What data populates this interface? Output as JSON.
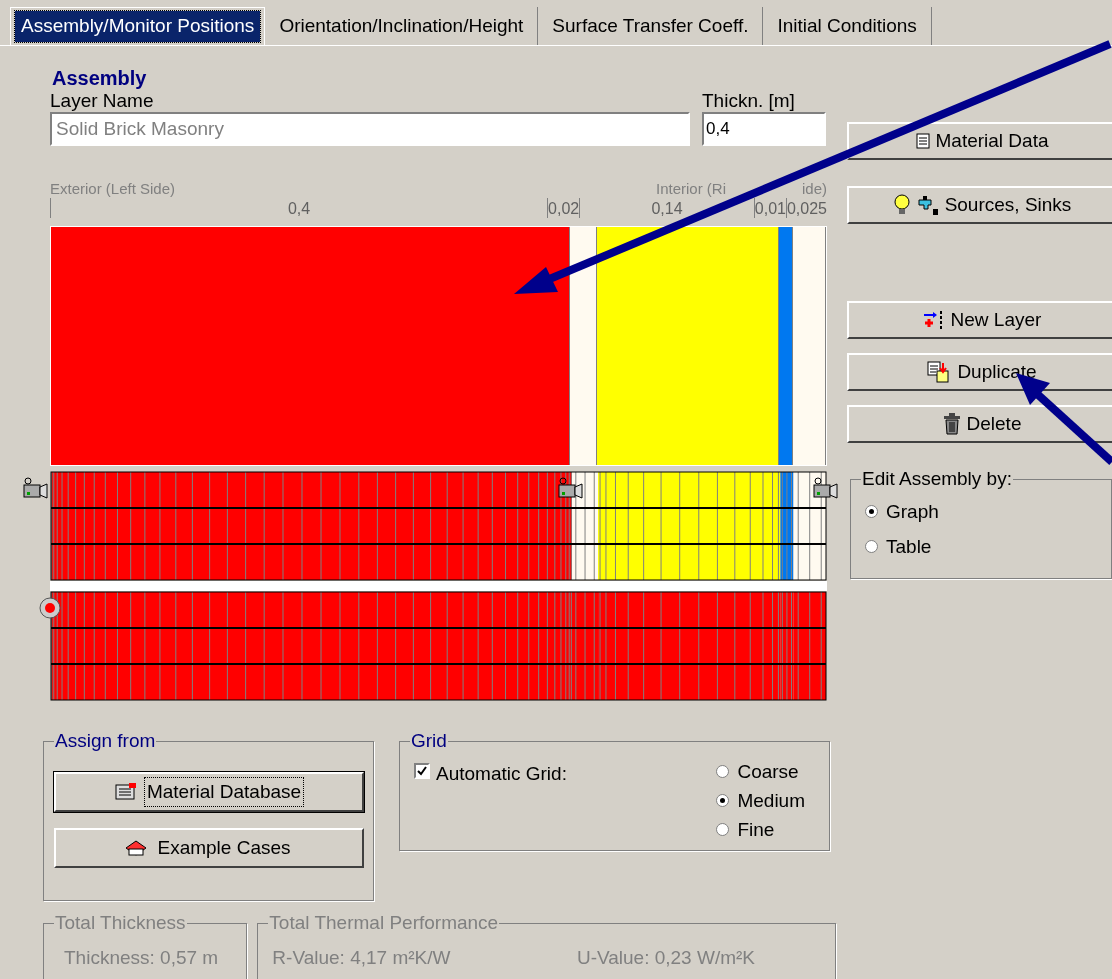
{
  "tabs": [
    {
      "label": "Assembly/Monitor Positions",
      "selected": true
    },
    {
      "label": "Orientation/Inclination/Height",
      "selected": false
    },
    {
      "label": "Surface Transfer Coeff.",
      "selected": false
    },
    {
      "label": "Initial Conditions",
      "selected": false
    }
  ],
  "assembly": {
    "title": "Assembly",
    "layer_name_label": "Layer Name",
    "layer_name_value": "Solid Brick Masonry",
    "layer_name_disabled": true,
    "thickness_label": "Thickn. [m]",
    "thickness_value": "0,4",
    "exterior_label": "Exterior (Left Side)",
    "interior_label": "Interior (Ri",
    "interior_label_tail": "ide)",
    "layers": [
      {
        "thickness": "0,4",
        "color": "#ff0000"
      },
      {
        "thickness": "0,02",
        "color": "#fffaf0"
      },
      {
        "thickness": "0,14",
        "color": "#ffff00"
      },
      {
        "thickness": "0,01",
        "color": "#0078f0"
      },
      {
        "thickness": "0,025",
        "color": "#fffaf0"
      }
    ]
  },
  "side_buttons": [
    {
      "label": "Material Data",
      "kind": "document"
    },
    {
      "label": "Sources, Sinks",
      "kind": "bulb-tap"
    },
    {
      "label": "New Layer",
      "kind": "new-layer"
    },
    {
      "label": "Duplicate",
      "kind": "duplicate"
    },
    {
      "label": "Delete",
      "kind": "trash"
    }
  ],
  "edit_by": {
    "title": "Edit Assembly by:",
    "options": [
      {
        "label": "Graph",
        "selected": true
      },
      {
        "label": "Table",
        "selected": false
      }
    ]
  },
  "assign_from": {
    "title": "Assign from",
    "buttons": [
      {
        "label": "Material Database",
        "kind": "database",
        "focused": true
      },
      {
        "label": "Example Cases",
        "kind": "cases",
        "focused": false
      }
    ]
  },
  "grid": {
    "title": "Grid",
    "automatic_label": "Automatic Grid:",
    "automatic_checked": true,
    "options": [
      {
        "label": "Coarse",
        "selected": false
      },
      {
        "label": "Medium",
        "selected": true
      },
      {
        "label": "Fine",
        "selected": false
      }
    ]
  },
  "total_thickness": {
    "title": "Total Thickness",
    "text": "Thickness: 0,57 m"
  },
  "total_performance": {
    "title": "Total Thermal Performance",
    "r_value": "R-Value: 4,17 m²K/W",
    "u_value": "U-Value: 0,23 W/m²K"
  }
}
